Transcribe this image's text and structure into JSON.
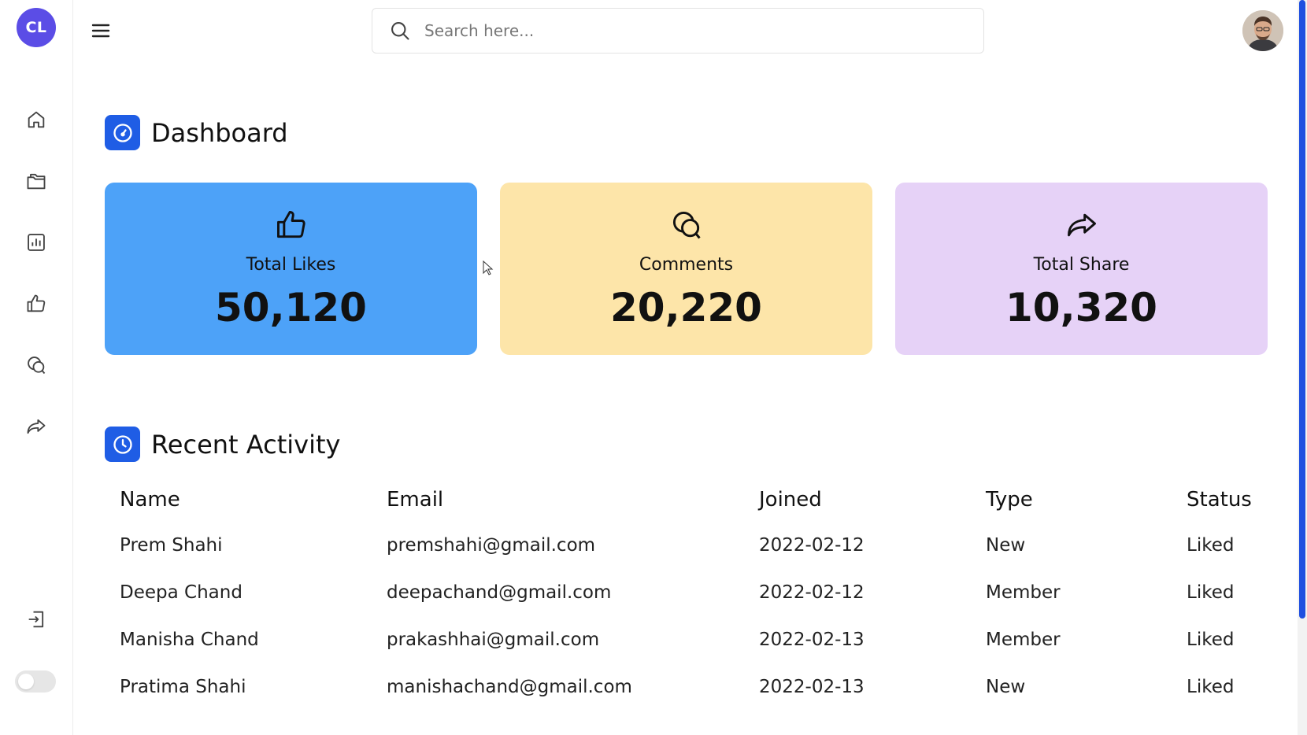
{
  "sidebar": {
    "logo": "CL",
    "items": [
      {
        "name": "home-icon"
      },
      {
        "name": "folders-icon"
      },
      {
        "name": "chart-icon"
      },
      {
        "name": "thumbs-up-icon"
      },
      {
        "name": "comments-icon"
      },
      {
        "name": "share-icon"
      }
    ],
    "logout_icon": "logout-icon",
    "theme_toggle": "off"
  },
  "topbar": {
    "menu_icon": "hamburger-icon",
    "search": {
      "placeholder": "Search here...",
      "value": ""
    },
    "avatar": "user-avatar"
  },
  "dashboard": {
    "title": "Dashboard",
    "icon": "speedometer-icon",
    "cards": [
      {
        "label": "Total Likes",
        "value": "50,120",
        "icon": "thumbs-up-icon",
        "color": "#4da2f8"
      },
      {
        "label": "Comments",
        "value": "20,220",
        "icon": "comments-icon",
        "color": "#fde5a9"
      },
      {
        "label": "Total Share",
        "value": "10,320",
        "icon": "share-icon",
        "color": "#e6d2f7"
      }
    ]
  },
  "recent_activity": {
    "title": "Recent Activity",
    "icon": "clock-icon",
    "columns": [
      "Name",
      "Email",
      "Joined",
      "Type",
      "Status"
    ],
    "rows": [
      [
        "Prem Shahi",
        "premshahi@gmail.com",
        "2022-02-12",
        "New",
        "Liked"
      ],
      [
        "Deepa Chand",
        "deepachand@gmail.com",
        "2022-02-12",
        "Member",
        "Liked"
      ],
      [
        "Manisha Chand",
        "prakashhai@gmail.com",
        "2022-02-13",
        "Member",
        "Liked"
      ],
      [
        "Pratima Shahi",
        "manishachand@gmail.com",
        "2022-02-13",
        "New",
        "Liked"
      ]
    ]
  },
  "colors": {
    "accent": "#1f5de5",
    "logo": "#5b4de6"
  }
}
